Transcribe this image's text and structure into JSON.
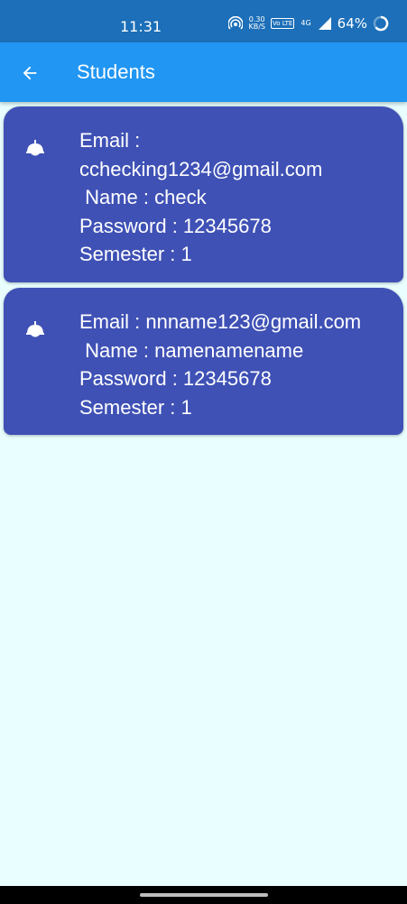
{
  "status_bar": {
    "time": "11:31",
    "net_speed_value": "0.30",
    "net_speed_unit": "KB/S",
    "volte_label": "Vo LTE",
    "network_label": "4G",
    "battery": "64%"
  },
  "app_bar": {
    "title": "Students",
    "back_icon": "arrow-left-icon"
  },
  "students": [
    {
      "icon": "bell-icon",
      "email_label": "Email :",
      "email": "cchecking1234@gmail.com",
      "name_line": " Name : check",
      "password_line": "Password : 12345678",
      "semester_line": "Semester : 1"
    },
    {
      "icon": "bell-icon",
      "email_line": "Email : nnname123@gmail.com",
      "name_line": " Name : namenamename",
      "password_line": "Password : 12345678",
      "semester_line": "Semester : 1"
    }
  ],
  "colors": {
    "status_bar": "#1c6fb8",
    "app_bar": "#2196f3",
    "card": "#3f51b5",
    "background": "#e8feff"
  }
}
